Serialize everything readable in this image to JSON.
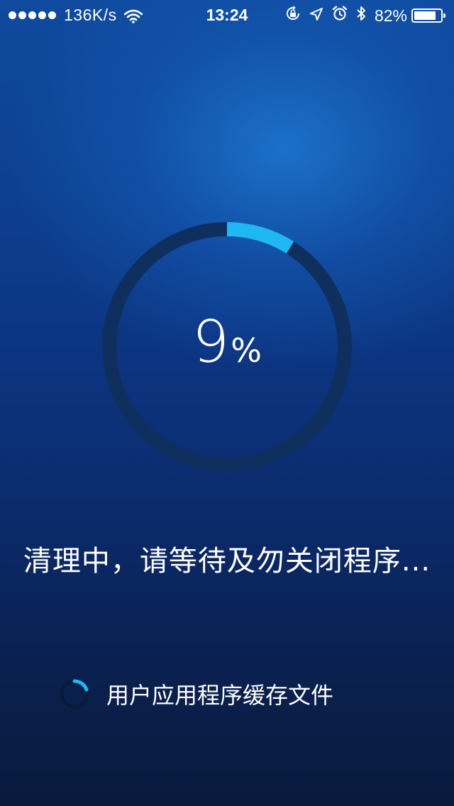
{
  "status_bar": {
    "signal_strength": 5,
    "net_speed": "136K/s",
    "time": "13:24",
    "battery_text": "82%",
    "battery_level": 0.82,
    "icons": [
      "wifi-icon",
      "rotation-lock-icon",
      "location-icon",
      "alarm-icon",
      "bluetooth-icon",
      "battery-icon"
    ]
  },
  "progress": {
    "value": 9,
    "number": "9",
    "unit": "%",
    "colors": {
      "track": "#0f2f5e",
      "arc": "#1fb8f5"
    }
  },
  "message": "清理中，请等待及勿关闭程序...",
  "current_item": {
    "label": "用户应用程序缓存文件",
    "icon": "spinner-icon"
  }
}
